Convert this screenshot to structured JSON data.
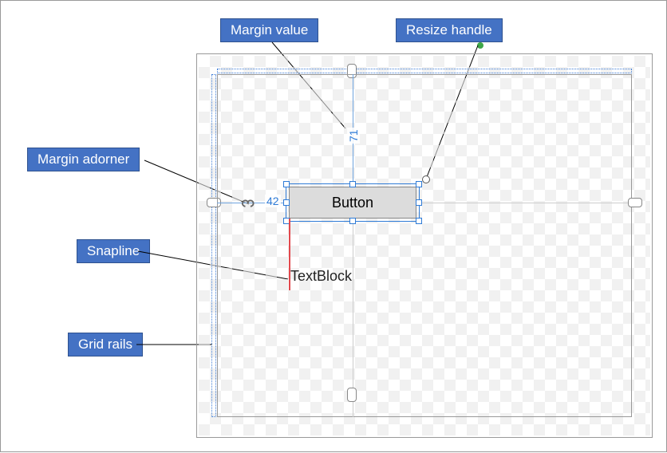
{
  "callouts": {
    "margin_value": "Margin value",
    "resize_handle": "Resize handle",
    "margin_adorner": "Margin adorner",
    "snapline": "Snapline",
    "grid_rails": "Grid rails"
  },
  "designer": {
    "button_label": "Button",
    "textblock_label": "TextBlock",
    "margin_top": "71",
    "margin_left": "42"
  }
}
